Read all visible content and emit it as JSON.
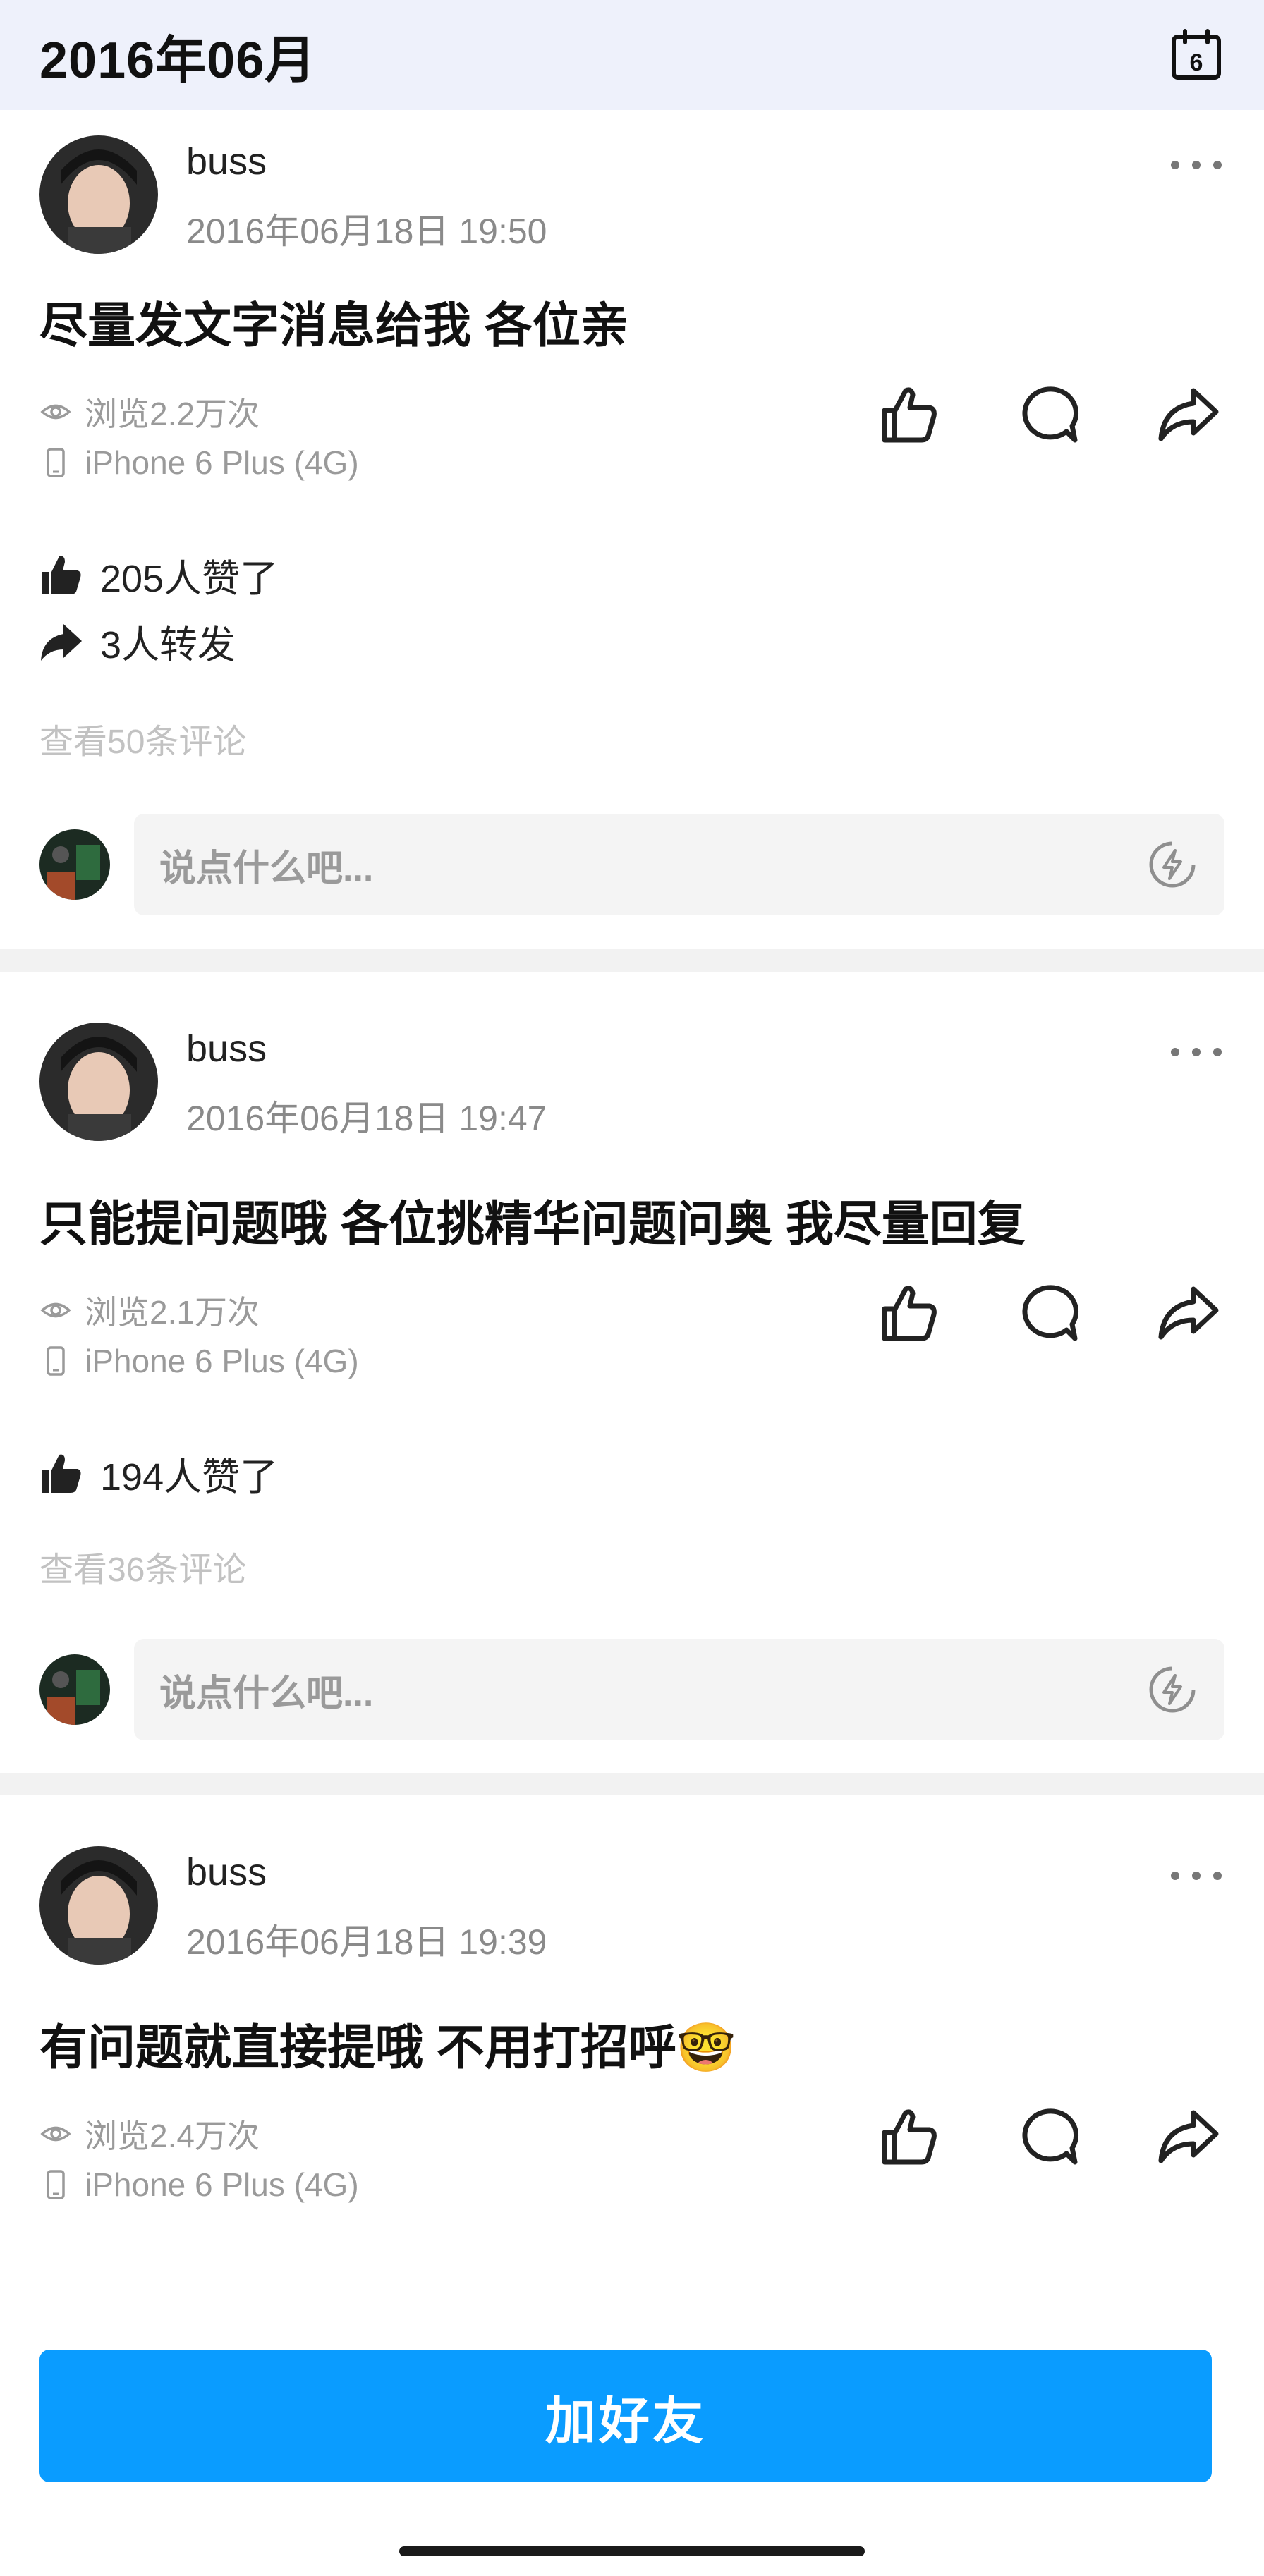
{
  "header": {
    "title": "2016年06月",
    "calendar_day": "6"
  },
  "posts": [
    {
      "username": "buss",
      "timestamp": "2016年06月18日 19:50",
      "text": "尽量发文字消息给我 各位亲",
      "views": "浏览2.2万次",
      "device": "iPhone 6 Plus (4G)",
      "likes": "205人赞了",
      "reposts": "3人转发",
      "view_comments": "查看50条评论",
      "comment_placeholder": "说点什么吧..."
    },
    {
      "username": "buss",
      "timestamp": "2016年06月18日 19:47",
      "text": "只能提问题哦 各位挑精华问题问奥 我尽量回复",
      "views": "浏览2.1万次",
      "device": "iPhone 6 Plus (4G)",
      "likes": "194人赞了",
      "view_comments": "查看36条评论",
      "comment_placeholder": "说点什么吧..."
    },
    {
      "username": "buss",
      "timestamp": "2016年06月18日 19:39",
      "text": "有问题就直接提哦 不用打招呼",
      "emoji": "🤓",
      "views": "浏览2.4万次",
      "device": "iPhone 6 Plus (4G)"
    }
  ],
  "footer": {
    "add_friend_label": "加好友"
  },
  "icons": [
    "calendar-icon",
    "more-icon",
    "eye-icon",
    "phone-icon",
    "like-icon",
    "comment-icon",
    "share-icon",
    "thumb-filled-icon",
    "forward-filled-icon",
    "bolt-icon"
  ],
  "colors": {
    "accent": "#0a9cff",
    "header_bg": "#eef1fb",
    "muted": "#9a9a9a",
    "divider": "#f2f2f2"
  }
}
